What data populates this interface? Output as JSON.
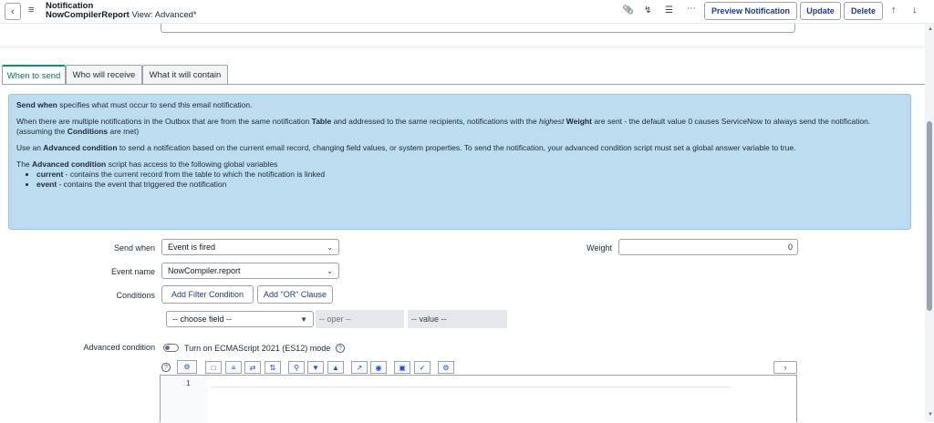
{
  "header": {
    "title": "Notification",
    "record_name": "NowCompilerReport",
    "view_label": "View: Advanced*",
    "buttons": {
      "preview": "Preview Notification",
      "update": "Update",
      "delete": "Delete"
    },
    "icons": [
      "paperclip-icon",
      "activity-icon",
      "settings-sliders-icon",
      "more-icon",
      "arrow-up-icon",
      "arrow-down-icon"
    ]
  },
  "tabs": [
    {
      "label": "When to send",
      "active": true
    },
    {
      "label": "Who will receive",
      "active": false
    },
    {
      "label": "What it will contain",
      "active": false
    }
  ],
  "info": {
    "p1_bold": "Send when",
    "p1_rest": " specifies what must occur to send this email notification.",
    "p2_a": "When there are multiple notifications in the Outbox that are from the same notification ",
    "p2_table": "Table",
    "p2_b": " and addressed to the same recipients, notifications with the ",
    "p2_highest": "highest",
    "p2_weight": "Weight",
    "p2_c": " are sent - the default value 0 causes ServiceNow to always send the notification. (assuming the ",
    "p2_conditions": "Conditions",
    "p2_d": " are met)",
    "p3_a": "Use an ",
    "p3_bold": "Advanced condition",
    "p3_b": " to send a notification based on the current email record, changing field values, or system properties. To send the notification, your advanced condition script must set a global answer variable to true.",
    "p4_a": "The ",
    "p4_bold": "Advanced condition",
    "p4_b": " script has access to the following global variables",
    "vars": [
      {
        "name": "current",
        "desc": " - contains the current record from the table to which the notification is linked"
      },
      {
        "name": "event",
        "desc": " - contains the event that triggered the notification"
      }
    ]
  },
  "form": {
    "send_when_label": "Send when",
    "send_when_value": "Event is fired",
    "weight_label": "Weight",
    "weight_value": "0",
    "event_name_label": "Event name",
    "event_name_value": "NowCompiler.report",
    "conditions_label": "Conditions",
    "add_filter": "Add Filter Condition",
    "add_or": "Add \"OR\" Clause",
    "choose_field": "-- choose field --",
    "oper": "-- oper --",
    "value": "-- value --",
    "advanced_label": "Advanced condition",
    "es_toggle_label": "Turn on ECMAScript 2021 (ES12) mode",
    "editor_line": "1"
  },
  "colors": {
    "accent": "#059669",
    "info_bg": "#bcdcef",
    "button_text": "#1e3a8a"
  }
}
